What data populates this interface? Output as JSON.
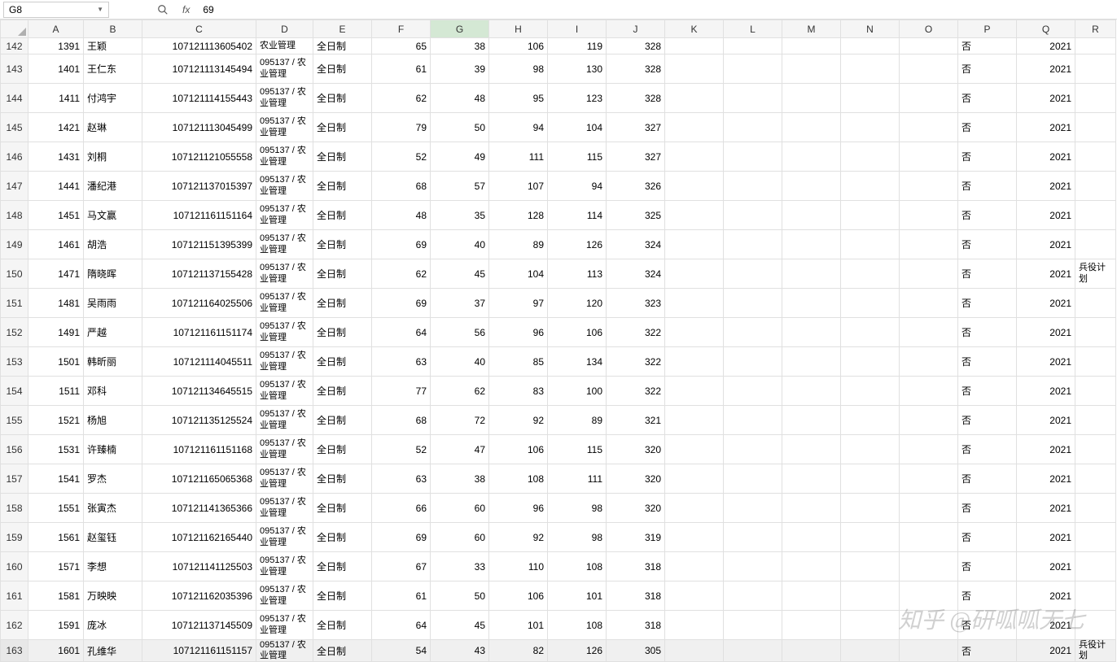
{
  "namebox": "G8",
  "fx": "fx",
  "formula": "69",
  "columns": [
    "A",
    "B",
    "C",
    "D",
    "E",
    "F",
    "G",
    "H",
    "I",
    "J",
    "K",
    "L",
    "M",
    "N",
    "O",
    "P",
    "Q",
    "R"
  ],
  "selectedCol": "G",
  "watermark": "知乎 @研呱呱无七",
  "rows": [
    {
      "n": 142,
      "a": "1391",
      "b": "王颖",
      "c": "107121113605402",
      "d": "农业管理",
      "e": "全日制",
      "f": "65",
      "g": "38",
      "h": "106",
      "i": "119",
      "j": "328",
      "p": "否",
      "q": "2021",
      "r": "",
      "partial": true
    },
    {
      "n": 143,
      "a": "1401",
      "b": "王仁东",
      "c": "107121113145494",
      "d": "095137 / 农业管理",
      "e": "全日制",
      "f": "61",
      "g": "39",
      "h": "98",
      "i": "130",
      "j": "328",
      "p": "否",
      "q": "2021",
      "r": ""
    },
    {
      "n": 144,
      "a": "1411",
      "b": "付鸿宇",
      "c": "107121114155443",
      "d": "095137 / 农业管理",
      "e": "全日制",
      "f": "62",
      "g": "48",
      "h": "95",
      "i": "123",
      "j": "328",
      "p": "否",
      "q": "2021",
      "r": ""
    },
    {
      "n": 145,
      "a": "1421",
      "b": "赵琳",
      "c": "107121113045499",
      "d": "095137 / 农业管理",
      "e": "全日制",
      "f": "79",
      "g": "50",
      "h": "94",
      "i": "104",
      "j": "327",
      "p": "否",
      "q": "2021",
      "r": ""
    },
    {
      "n": 146,
      "a": "1431",
      "b": "刘桐",
      "c": "107121121055558",
      "d": "095137 / 农业管理",
      "e": "全日制",
      "f": "52",
      "g": "49",
      "h": "111",
      "i": "115",
      "j": "327",
      "p": "否",
      "q": "2021",
      "r": ""
    },
    {
      "n": 147,
      "a": "1441",
      "b": "潘纪港",
      "c": "107121137015397",
      "d": "095137 / 农业管理",
      "e": "全日制",
      "f": "68",
      "g": "57",
      "h": "107",
      "i": "94",
      "j": "326",
      "p": "否",
      "q": "2021",
      "r": ""
    },
    {
      "n": 148,
      "a": "1451",
      "b": "马文赢",
      "c": "107121161151164",
      "d": "095137 / 农业管理",
      "e": "全日制",
      "f": "48",
      "g": "35",
      "h": "128",
      "i": "114",
      "j": "325",
      "p": "否",
      "q": "2021",
      "r": ""
    },
    {
      "n": 149,
      "a": "1461",
      "b": "胡浩",
      "c": "107121151395399",
      "d": "095137 / 农业管理",
      "e": "全日制",
      "f": "69",
      "g": "40",
      "h": "89",
      "i": "126",
      "j": "324",
      "p": "否",
      "q": "2021",
      "r": ""
    },
    {
      "n": 150,
      "a": "1471",
      "b": "隋晓晖",
      "c": "107121137155428",
      "d": "095137 / 农业管理",
      "e": "全日制",
      "f": "62",
      "g": "45",
      "h": "104",
      "i": "113",
      "j": "324",
      "p": "否",
      "q": "2021",
      "r": "兵役计划"
    },
    {
      "n": 151,
      "a": "1481",
      "b": "吴雨雨",
      "c": "107121164025506",
      "d": "095137 / 农业管理",
      "e": "全日制",
      "f": "69",
      "g": "37",
      "h": "97",
      "i": "120",
      "j": "323",
      "p": "否",
      "q": "2021",
      "r": ""
    },
    {
      "n": 152,
      "a": "1491",
      "b": "严越",
      "c": "107121161151174",
      "d": "095137 / 农业管理",
      "e": "全日制",
      "f": "64",
      "g": "56",
      "h": "96",
      "i": "106",
      "j": "322",
      "p": "否",
      "q": "2021",
      "r": ""
    },
    {
      "n": 153,
      "a": "1501",
      "b": "韩昕丽",
      "c": "107121114045511",
      "d": "095137 / 农业管理",
      "e": "全日制",
      "f": "63",
      "g": "40",
      "h": "85",
      "i": "134",
      "j": "322",
      "p": "否",
      "q": "2021",
      "r": ""
    },
    {
      "n": 154,
      "a": "1511",
      "b": "邓科",
      "c": "107121134645515",
      "d": "095137 / 农业管理",
      "e": "全日制",
      "f": "77",
      "g": "62",
      "h": "83",
      "i": "100",
      "j": "322",
      "p": "否",
      "q": "2021",
      "r": ""
    },
    {
      "n": 155,
      "a": "1521",
      "b": "杨旭",
      "c": "107121135125524",
      "d": "095137 / 农业管理",
      "e": "全日制",
      "f": "68",
      "g": "72",
      "h": "92",
      "i": "89",
      "j": "321",
      "p": "否",
      "q": "2021",
      "r": ""
    },
    {
      "n": 156,
      "a": "1531",
      "b": "许臻楠",
      "c": "107121161151168",
      "d": "095137 / 农业管理",
      "e": "全日制",
      "f": "52",
      "g": "47",
      "h": "106",
      "i": "115",
      "j": "320",
      "p": "否",
      "q": "2021",
      "r": ""
    },
    {
      "n": 157,
      "a": "1541",
      "b": "罗杰",
      "c": "107121165065368",
      "d": "095137 / 农业管理",
      "e": "全日制",
      "f": "63",
      "g": "38",
      "h": "108",
      "i": "111",
      "j": "320",
      "p": "否",
      "q": "2021",
      "r": ""
    },
    {
      "n": 158,
      "a": "1551",
      "b": "张寅杰",
      "c": "107121141365366",
      "d": "095137 / 农业管理",
      "e": "全日制",
      "f": "66",
      "g": "60",
      "h": "96",
      "i": "98",
      "j": "320",
      "p": "否",
      "q": "2021",
      "r": ""
    },
    {
      "n": 159,
      "a": "1561",
      "b": "赵玺钰",
      "c": "107121162165440",
      "d": "095137 / 农业管理",
      "e": "全日制",
      "f": "69",
      "g": "60",
      "h": "92",
      "i": "98",
      "j": "319",
      "p": "否",
      "q": "2021",
      "r": ""
    },
    {
      "n": 160,
      "a": "1571",
      "b": "李想",
      "c": "107121141125503",
      "d": "095137 / 农业管理",
      "e": "全日制",
      "f": "67",
      "g": "33",
      "h": "110",
      "i": "108",
      "j": "318",
      "p": "否",
      "q": "2021",
      "r": ""
    },
    {
      "n": 161,
      "a": "1581",
      "b": "万映映",
      "c": "107121162035396",
      "d": "095137 / 农业管理",
      "e": "全日制",
      "f": "61",
      "g": "50",
      "h": "106",
      "i": "101",
      "j": "318",
      "p": "否",
      "q": "2021",
      "r": ""
    },
    {
      "n": 162,
      "a": "1591",
      "b": "庞冰",
      "c": "107121137145509",
      "d": "095137 / 农业管理",
      "e": "全日制",
      "f": "64",
      "g": "45",
      "h": "101",
      "i": "108",
      "j": "318",
      "p": "否",
      "q": "2021",
      "r": ""
    },
    {
      "n": 163,
      "a": "1601",
      "b": "孔维华",
      "c": "107121161151157",
      "d": "095137 / 农业管理",
      "e": "全日制",
      "f": "54",
      "g": "43",
      "h": "82",
      "i": "126",
      "j": "305",
      "p": "否",
      "q": "2021",
      "r": "兵役计划",
      "hover": true,
      "partial2": true
    }
  ]
}
